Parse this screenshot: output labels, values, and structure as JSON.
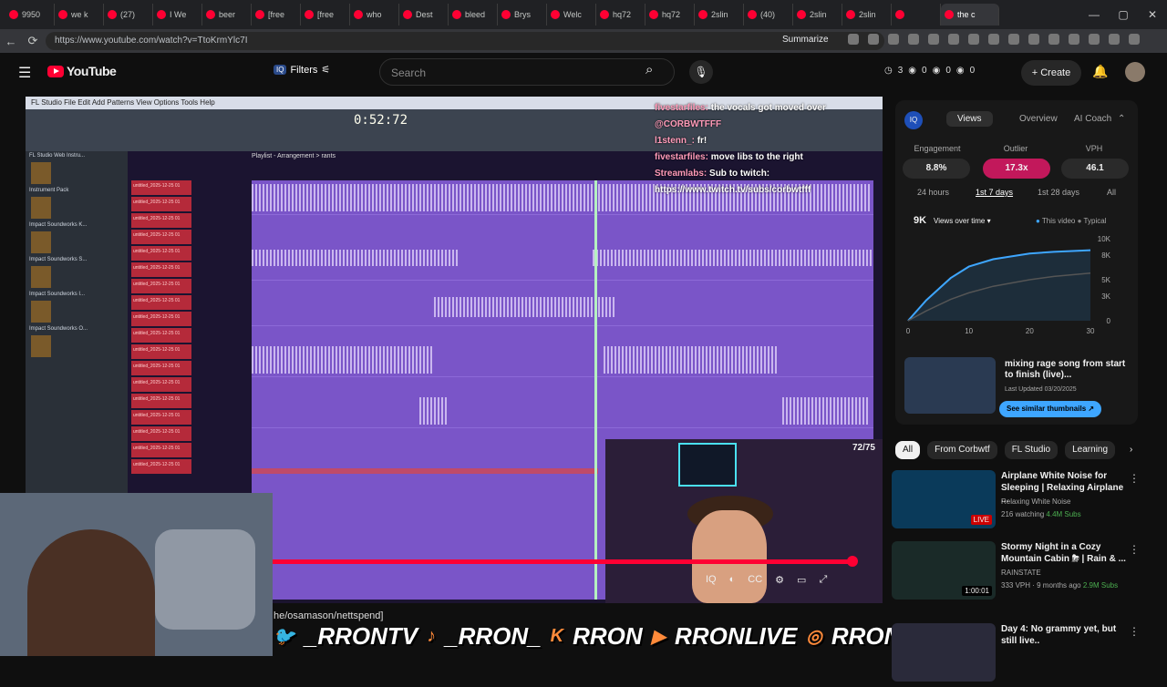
{
  "browser": {
    "tabs": [
      "9950",
      "we k",
      "(27)",
      "I We",
      "beer",
      "[free",
      "[free",
      "who",
      "Dest",
      "bleed",
      "Brys",
      "Welc",
      "hq72",
      "hq72",
      "2slin",
      "(40)",
      "2slin",
      "2slin",
      "",
      "the c"
    ],
    "url": "https://www.youtube.com/watch?v=TtoKrmYlc7I",
    "summarize": "Summarize"
  },
  "youtube": {
    "logo": "YouTube",
    "filters": "Filters",
    "search_placeholder": "Search",
    "counts": [
      "3",
      "0",
      "0",
      "0"
    ],
    "create": "Create"
  },
  "video": {
    "fl_menu": "FL Studio   File   Edit   Add   Patterns   View   Options   Tools   Help",
    "time": "0:52:72",
    "playlist_title": "Playlist - Arrangement > rants",
    "browser_items": [
      "FL Studio Web Instru...",
      "Instrument Pack",
      "Impact Soundworks K...",
      "Impact Soundworks S...",
      "Impact Soundworks I...",
      "Impact Soundworks O..."
    ],
    "track_labels": [
      "untitled_2025-12-25 01",
      "untitled_2025-12-25 01",
      "untitled_2025-12-25 01",
      "untitled_2025-12-25 01",
      "untitled_2025-12-25 01",
      "untitled_2025-12-25 01",
      "untitled_2025-12-25 01",
      "untitled_2025-12-25 01",
      "untitled_2025-12-25 01",
      "untitled_2025-12-25 01",
      "untitled_2025-12-25 01",
      "untitled_2025-12-25 01",
      "untitled_2025-12-25 01",
      "untitled_2025-12-25 01",
      "untitled_2025-12-25 01",
      "untitled_2025-12-25 01",
      "untitled_2025-12-25 01",
      "untitled_2025-12-25 01"
    ],
    "chat": [
      {
        "user": "fivestarfiles:",
        "msg": "the vocals got moved over"
      },
      {
        "user": "@CORBWTFFF",
        "msg": ""
      },
      {
        "user": "l1stenn_:",
        "msg": "fr!"
      },
      {
        "user": "fivestarfiles:",
        "msg": "move libs to the right"
      },
      {
        "user": "Streamlabs:",
        "msg": "Sub to twitch:"
      },
      {
        "user": "",
        "msg": "https://www.twitch.tv/subs/corbwtfff"
      }
    ],
    "counter": "72/75",
    "progress": 0.965,
    "handle": "he/osamason/nettspend]",
    "socials": [
      "_RRONTV",
      "_RRON_",
      "RRON",
      "RRONLIVE",
      "RRONTV"
    ]
  },
  "analytics": {
    "tabs": [
      "Views",
      "Overview",
      "AI Coach"
    ],
    "metrics": [
      {
        "label": "Engagement",
        "value": "8.8%"
      },
      {
        "label": "Outlier",
        "value": "17.3x"
      },
      {
        "label": "VPH",
        "value": "46.1"
      }
    ],
    "periods": [
      "24 hours",
      "1st 7 days",
      "1st 28 days",
      "All"
    ],
    "views_total": "9K",
    "views_dropdown": "Views over time",
    "legend": [
      "This video",
      "Typical"
    ],
    "chart_data": {
      "type": "line",
      "x": [
        0,
        3,
        7,
        10,
        14,
        20,
        24,
        30
      ],
      "series": [
        {
          "name": "This video",
          "values": [
            0,
            2500,
            5200,
            6600,
            7500,
            8200,
            8400,
            8600
          ]
        },
        {
          "name": "Typical",
          "values": [
            0,
            1200,
            2600,
            3400,
            4200,
            5000,
            5400,
            5800
          ]
        }
      ],
      "xticks": [
        "0",
        "10",
        "20",
        "30"
      ],
      "yticks": [
        "10K",
        "8K",
        "5K",
        "3K",
        "0"
      ],
      "ylim": [
        0,
        10000
      ]
    },
    "recommended": {
      "title": "mixing rage song from start to finish (live)...",
      "updated": "Last Updated 03/20/2025",
      "button": "See similar thumbnails"
    }
  },
  "chips": [
    "All",
    "From Corbwtf",
    "FL Studio",
    "Learning"
  ],
  "related": [
    {
      "title": "Airplane White Noise for Sleeping | Relaxing Airplane ...",
      "channel": "Relaxing White Noise",
      "stats": "216 watching",
      "badge": "LIVE",
      "extra": "4.4M Subs"
    },
    {
      "title": "Stormy Night in a Cozy Mountain Cabin ⛈ | Rain & ...",
      "channel": "RAINSTATE",
      "stats": "333 VPH · 9 months ago",
      "badge": "1:00:01",
      "extra": "2.9M Subs"
    },
    {
      "title": "Day 4: No grammy yet, but still live..",
      "channel": "",
      "stats": "",
      "badge": "",
      "extra": ""
    }
  ]
}
